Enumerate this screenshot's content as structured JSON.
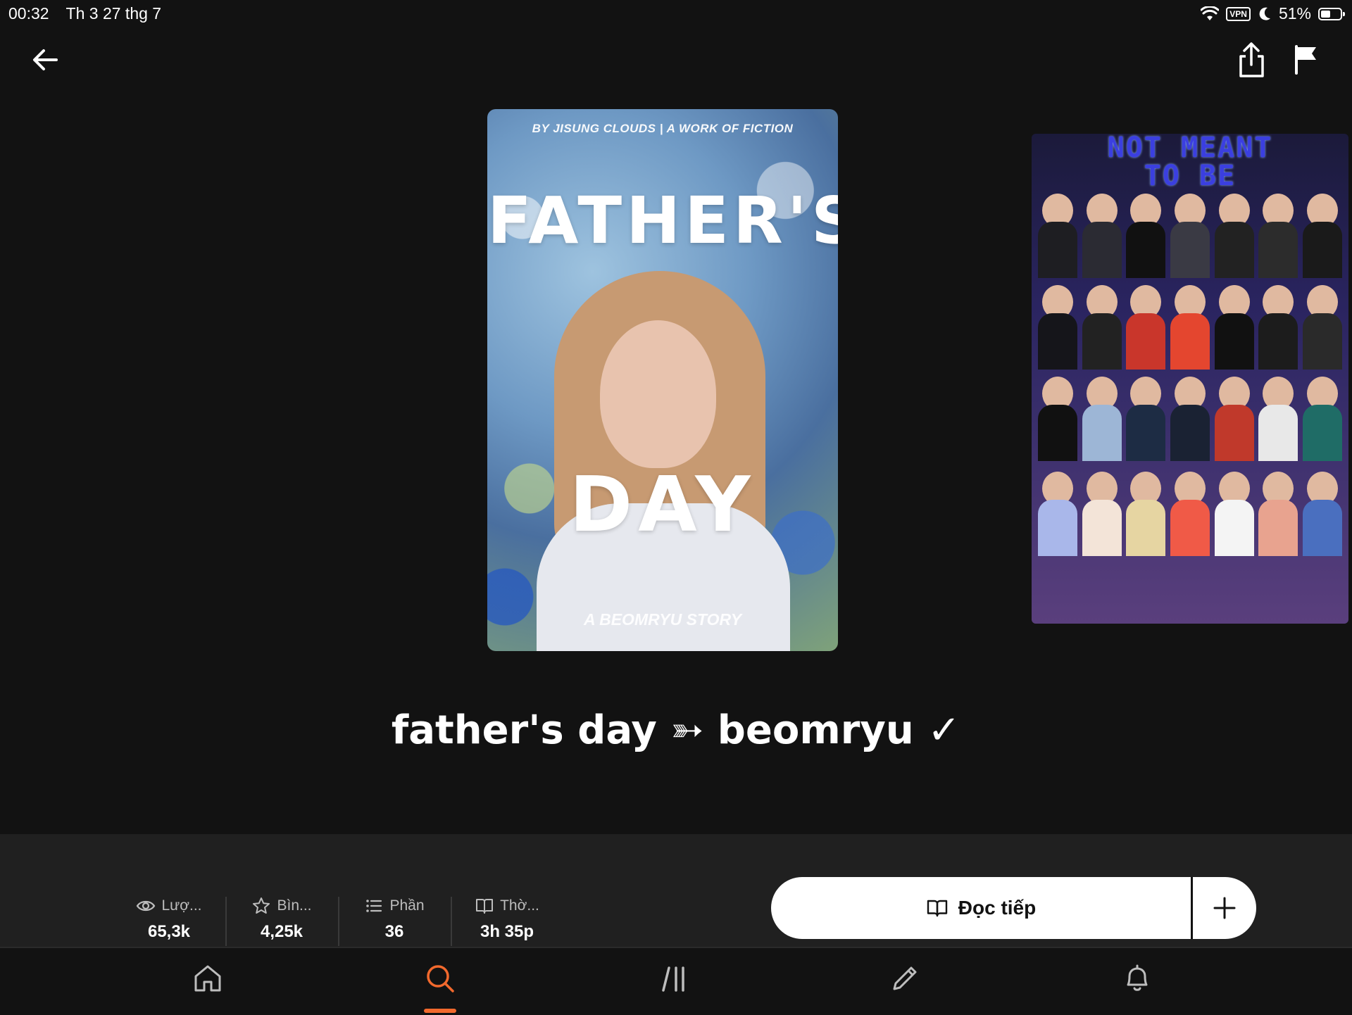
{
  "status_bar": {
    "time": "00:32",
    "date": "Th 3 27 thg 7",
    "vpn_label": "VPN",
    "battery_percent": "51%",
    "battery_level": 0.51
  },
  "story": {
    "title": "father's day ➳ beomryu ✓",
    "cover": {
      "byline": "BY JISUNG CLOUDS | A WORK OF FICTION",
      "title_line1": "FATHER'S",
      "title_line2": "DAY",
      "footer": "A BEOMRYU STORY"
    },
    "next_cover": {
      "title_line1": "NOT MEANT",
      "title_line2": "TO BE"
    }
  },
  "stats": [
    {
      "icon": "eye-icon",
      "label": "Lượ...",
      "value": "65,3k"
    },
    {
      "icon": "star-icon",
      "label": "Bìn...",
      "value": "4,25k"
    },
    {
      "icon": "list-icon",
      "label": "Phần",
      "value": "36"
    },
    {
      "icon": "book-icon",
      "label": "Thờ...",
      "value": "3h 35p"
    }
  ],
  "actions": {
    "continue_reading": "Đọc tiếp"
  },
  "colors": {
    "accent": "#f2692d",
    "background": "#121212",
    "panel": "#202020"
  }
}
